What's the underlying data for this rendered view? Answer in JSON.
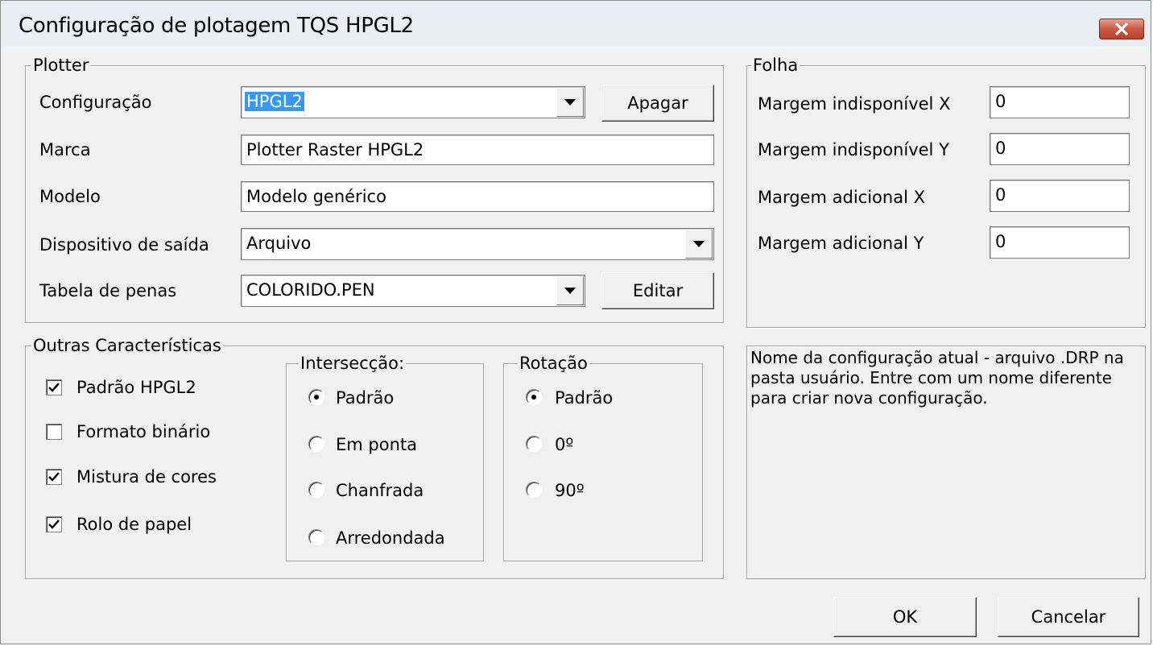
{
  "window": {
    "title": "Configuração de plotagem TQS HPGL2",
    "close_icon": "close-icon"
  },
  "plotter": {
    "legend": "Plotter",
    "configuracao_label": "Configuração",
    "configuracao_value": "HPGL2",
    "apagar_button": "Apagar",
    "marca_label": "Marca",
    "marca_value": "Plotter Raster HPGL2",
    "modelo_label": "Modelo",
    "modelo_value": "Modelo genérico",
    "dispositivo_label": "Dispositivo de saída",
    "dispositivo_value": "Arquivo",
    "tabela_label": "Tabela de penas",
    "tabela_value": "COLORIDO.PEN",
    "editar_button": "Editar"
  },
  "folha": {
    "legend": "Folha",
    "fields": [
      {
        "label": "Margem indisponível X",
        "value": "0"
      },
      {
        "label": "Margem indisponível Y",
        "value": "0"
      },
      {
        "label": "Margem adicional X",
        "value": "0"
      },
      {
        "label": "Margem adicional Y",
        "value": "0"
      }
    ]
  },
  "outras": {
    "legend": "Outras Características",
    "checkboxes": [
      {
        "label": "Padrão HPGL2",
        "checked": true
      },
      {
        "label": "Formato binário",
        "checked": false
      },
      {
        "label": "Mistura de cores",
        "checked": true
      },
      {
        "label": "Rolo de papel",
        "checked": true
      }
    ],
    "interseccao": {
      "legend": "Intersecção:",
      "options": [
        {
          "label": "Padrão",
          "selected": true
        },
        {
          "label": "Em ponta",
          "selected": false
        },
        {
          "label": "Chanfrada",
          "selected": false
        },
        {
          "label": "Arredondada",
          "selected": false
        }
      ]
    },
    "rotacao": {
      "legend": "Rotação",
      "options": [
        {
          "label": "Padrão",
          "selected": true
        },
        {
          "label": "0º",
          "selected": false
        },
        {
          "label": "90º",
          "selected": false
        }
      ]
    }
  },
  "info": {
    "text": "Nome da configuração atual - arquivo .DRP na pasta usuário. Entre com um nome diferente para criar nova configuração."
  },
  "footer": {
    "ok_button": "OK",
    "cancel_button": "Cancelar"
  }
}
